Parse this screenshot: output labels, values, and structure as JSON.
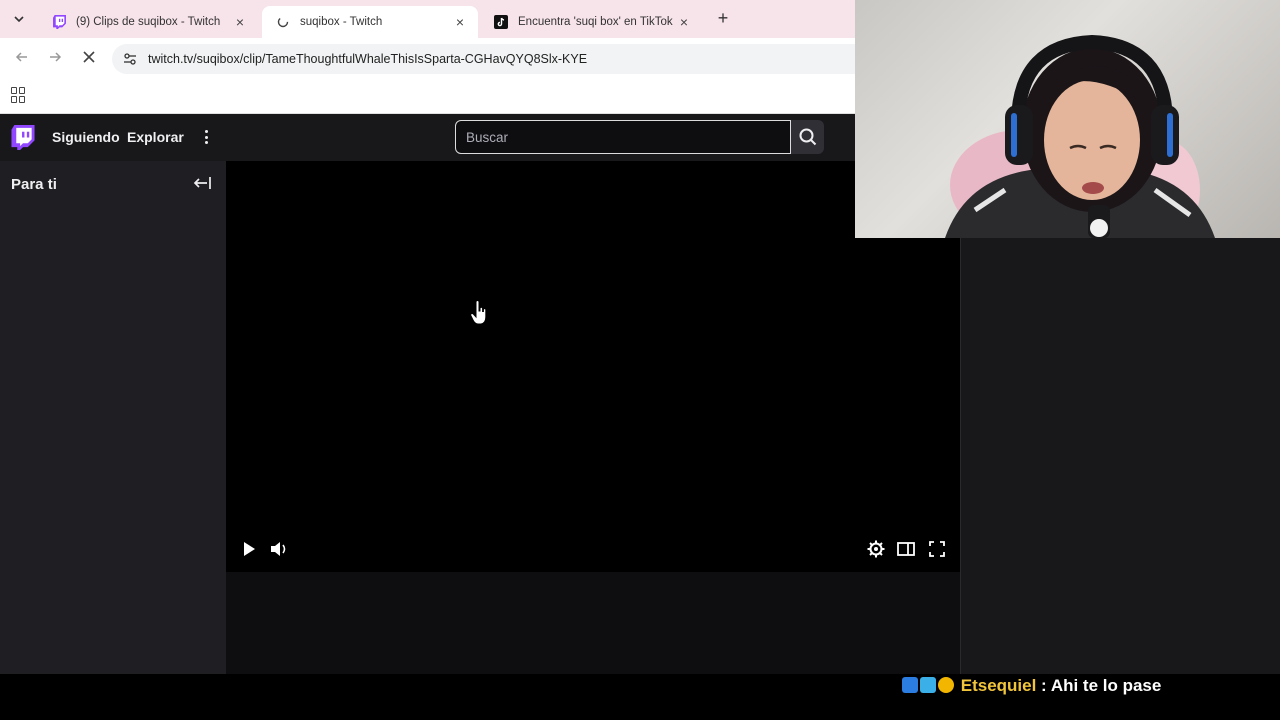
{
  "browser": {
    "tabs": [
      {
        "label": "(9) Clips de suqibox - Twitch",
        "active": false,
        "favicon": "twitch-favicon"
      },
      {
        "label": "suqibox - Twitch",
        "active": true,
        "favicon": "loading-favicon"
      },
      {
        "label": "Encuentra 'suqi box' en TikTok |",
        "active": false,
        "favicon": "tiktok-favicon"
      }
    ],
    "url": "twitch.tv/suqibox/clip/TameThoughtfulWhaleThisIsSparta-CGHavQYQ8Slx-KYE"
  },
  "twitch": {
    "nav": {
      "following": "Siguiendo",
      "browse": "Explorar"
    },
    "search": {
      "placeholder": "Buscar"
    },
    "sidebar": {
      "title": "Para ti"
    },
    "brand_color": "#9146ff"
  },
  "chat_overlay": {
    "username": "Etsequiel",
    "separator": " : ",
    "message": "Ahi te lo pase",
    "username_color": "#f0c43b"
  }
}
